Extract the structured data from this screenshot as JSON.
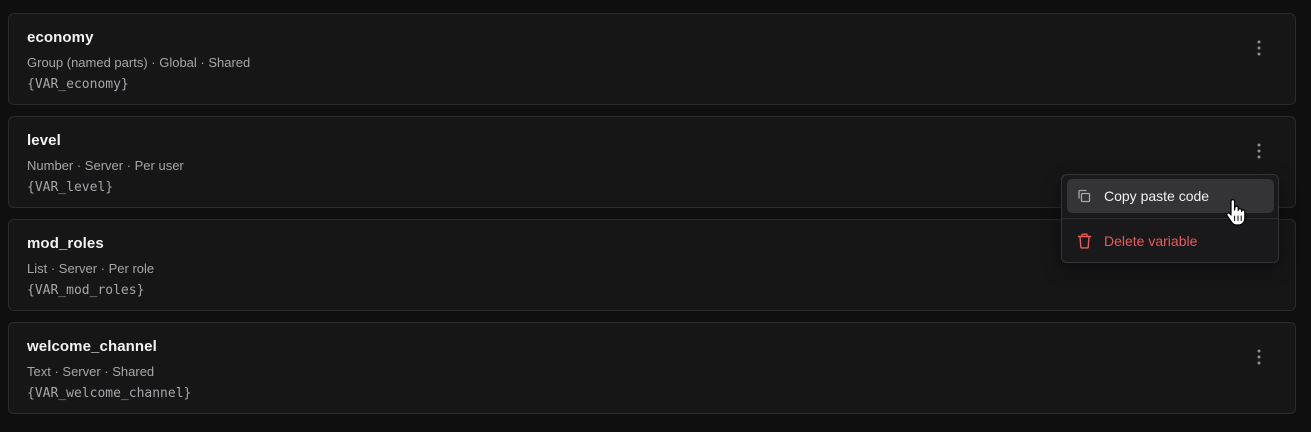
{
  "variables": [
    {
      "name": "economy",
      "meta": "Group (named parts) · Global · Shared",
      "code": "{VAR_economy}"
    },
    {
      "name": "level",
      "meta": "Number · Server · Per user",
      "code": "{VAR_level}"
    },
    {
      "name": "mod_roles",
      "meta": "List · Server · Per role",
      "code": "{VAR_mod_roles}"
    },
    {
      "name": "welcome_channel",
      "meta": "Text · Server · Shared",
      "code": "{VAR_welcome_channel}"
    }
  ],
  "context_menu": {
    "copy_label": "Copy paste code",
    "copy_icon": "copy-icon",
    "delete_label": "Delete variable",
    "delete_icon": "trash-icon",
    "delete_color": "#ea5a5a"
  },
  "colors": {
    "background": "#0f0f10",
    "card": "#161617",
    "border": "#2b2b2e",
    "hover": "#343437"
  }
}
